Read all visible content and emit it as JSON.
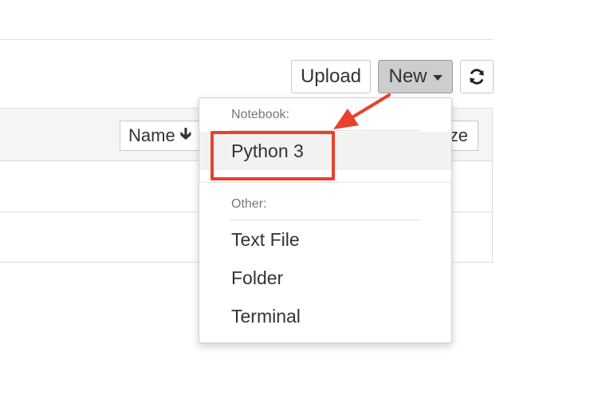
{
  "toolbar": {
    "upload_label": "Upload",
    "new_label": "New",
    "new_icon": "caret-down-icon",
    "refresh_icon": "refresh-icon"
  },
  "file_list": {
    "sort_name_label": "Name",
    "sort_name_icon": "arrow-down-icon",
    "sort_size_label": "ze"
  },
  "new_menu": {
    "notebook_header": "Notebook:",
    "notebook_items": [
      "Python 3"
    ],
    "other_header": "Other:",
    "other_items": [
      "Text File",
      "Folder",
      "Terminal"
    ]
  },
  "annotation": {
    "highlight_color": "#e8412c",
    "target": "Python 3"
  }
}
